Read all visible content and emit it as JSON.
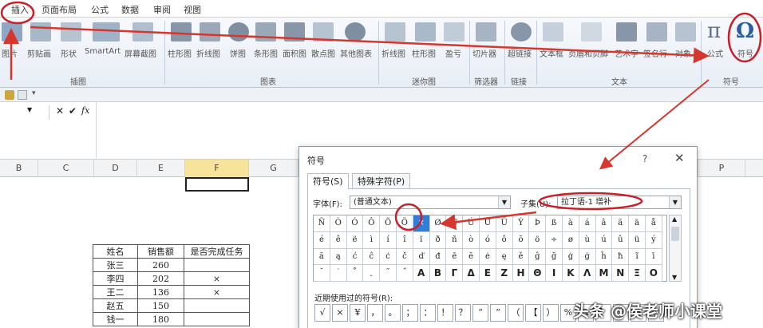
{
  "ribbon_tabs": [
    "插入",
    "页面布局",
    "公式",
    "数据",
    "审阅",
    "视图"
  ],
  "ribbon_buttons": [
    "图片",
    "剪贴画",
    "形状",
    "SmartArt",
    "屏幕截图",
    "柱形图",
    "折线图",
    "饼图",
    "条形图",
    "面积图",
    "散点图",
    "其他图表",
    "折线图",
    "柱形图",
    "盈亏",
    "切片器",
    "超链接",
    "文本框",
    "页眉和页脚",
    "艺术字",
    "签名行",
    "对象",
    "公式",
    "符号"
  ],
  "ribbon_groups": [
    "插图",
    "图表",
    "迷你图",
    "筛选器",
    "链接",
    "文本",
    "符号"
  ],
  "formula_bar": {
    "fx": "fx",
    "cancel": "✕",
    "enter": "✔"
  },
  "columns": [
    "B",
    "C",
    "D",
    "E",
    "F",
    "G",
    "P"
  ],
  "table": {
    "headers": [
      "姓名",
      "销售额",
      "是否完成任务"
    ],
    "rows": [
      [
        "张三",
        "260",
        ""
      ],
      [
        "李四",
        "202",
        "×"
      ],
      [
        "王二",
        "136",
        "×"
      ],
      [
        "赵五",
        "150",
        ""
      ],
      [
        "钱一",
        "180",
        ""
      ]
    ]
  },
  "dialog": {
    "title": "符号",
    "help": "?",
    "close": "✕",
    "tabs": [
      "符号(S)",
      "特殊字符(P)"
    ],
    "font_label": "字体(F):",
    "font_value": "(普通文本)",
    "subset_label": "子集(U):",
    "subset_value": "拉丁语-1 增补",
    "symbols": [
      [
        "Ñ",
        "Ò",
        "Ó",
        "Ô",
        "Õ",
        "Ö",
        "×",
        "Ø",
        "Ù",
        "Ú",
        "Û",
        "Ü",
        "Ý",
        "Þ",
        "ß",
        "à",
        "á",
        "â",
        "ã",
        "ä",
        "å",
        "æ",
        "ç",
        "è"
      ],
      [
        "é",
        "ê",
        "ë",
        "ì",
        "í",
        "î",
        "ï",
        "ð",
        "ñ",
        "ò",
        "ó",
        "ô",
        "õ",
        "ö",
        "÷",
        "ø",
        "ù",
        "ú",
        "û",
        "ü",
        "ý",
        "þ",
        "ÿ",
        "ā"
      ],
      [
        "ă",
        "ą",
        "ć",
        "ĉ",
        "ċ",
        "č",
        "ď",
        "đ",
        "ē",
        "ĕ",
        "ė",
        "ę",
        "ě",
        "ĝ",
        "ğ",
        "ġ",
        "ģ",
        "ĥ",
        "ħ",
        "ĩ",
        "ī",
        "ĭ",
        "į",
        "ı"
      ],
      [
        "˘",
        "˙",
        "˚",
        "˛",
        "˜",
        "˝",
        "Α",
        "Β",
        "Γ",
        "Δ",
        "Ε",
        "Ζ",
        "Η",
        "Θ",
        "Ι",
        "Κ",
        "Λ",
        "Μ",
        "Ν",
        "Ξ",
        "Ο",
        "Π",
        "Ρ",
        "Σ"
      ]
    ],
    "recent_label": "近期使用过的符号(R):",
    "recent": [
      "√",
      "×",
      "¥",
      "，",
      "。",
      "；",
      "：",
      "！",
      "？",
      "“",
      "”",
      "（",
      "【",
      "）",
      "%",
      "&",
      "】",
      "*",
      "§",
      "©",
      "®",
      "™",
      "€"
    ]
  },
  "watermark": "头条 @侯老师小课堂",
  "colors": {
    "arrow": "#d5372f",
    "highlight": "#c91f2a",
    "selected": "#2f7fd8"
  }
}
